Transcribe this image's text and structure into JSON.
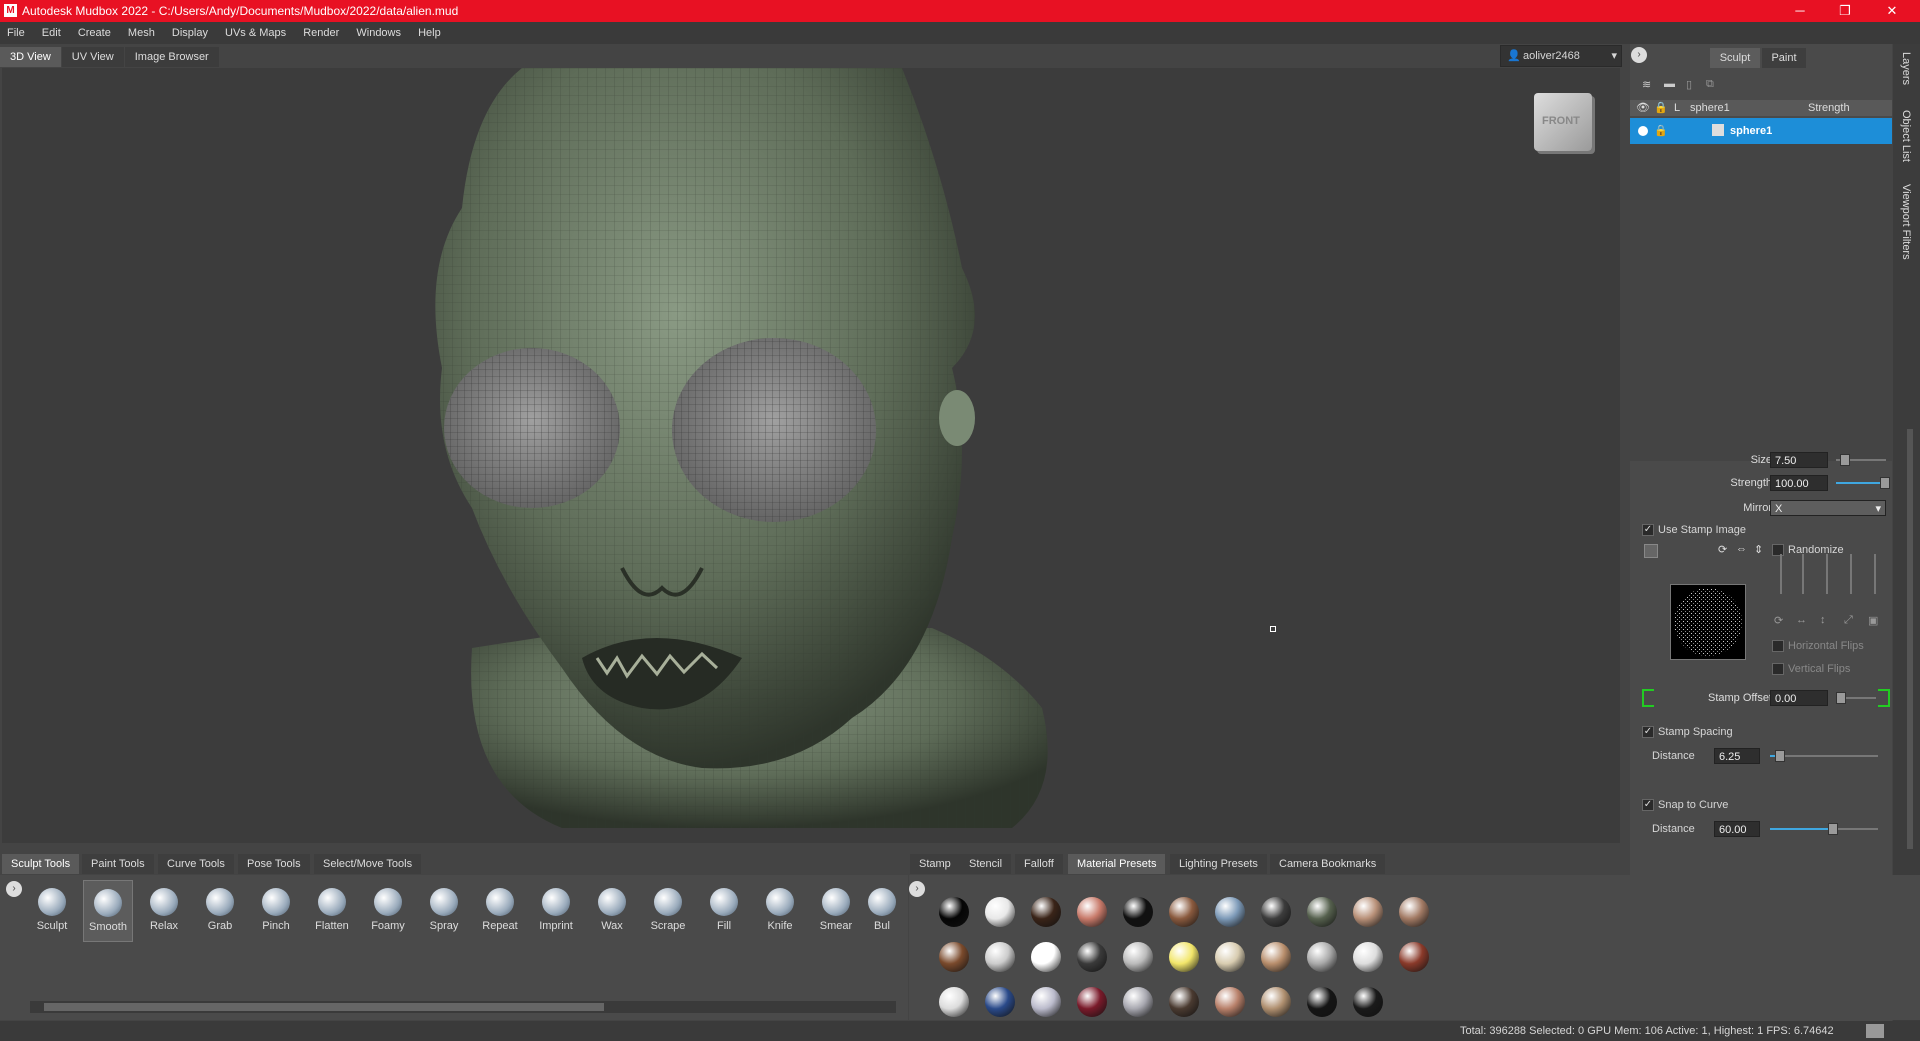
{
  "window": {
    "title": "Autodesk Mudbox 2022 - C:/Users/Andy/Documents/Mudbox/2022/data/alien.mud",
    "minimize": "─",
    "maximize": "❐",
    "close": "✕"
  },
  "menu": [
    "File",
    "Edit",
    "Create",
    "Mesh",
    "Display",
    "UVs & Maps",
    "Render",
    "Windows",
    "Help"
  ],
  "view_tabs": [
    "3D View",
    "UV View",
    "Image Browser"
  ],
  "user": {
    "name": "aoliver2468"
  },
  "viewcube": {
    "label": "FRONT"
  },
  "mode_tabs": [
    "Sculpt",
    "Paint"
  ],
  "side_tabs": [
    "Layers",
    "Object List",
    "Viewport Filters"
  ],
  "layers": {
    "header_name": "sphere1",
    "header_strength": "Strength",
    "header_l": "L",
    "row_name": "sphere1"
  },
  "properties": {
    "size_label": "Size",
    "size_value": "7.50",
    "size_level": 0.08,
    "strength_label": "Strength",
    "strength_value": "100.00",
    "strength_level": 1.0,
    "mirror_label": "Mirror",
    "mirror_value": "X",
    "use_stamp_label": "Use Stamp Image",
    "randomize_label": "Randomize",
    "hflips_label": "Horizontal Flips",
    "vflips_label": "Vertical Flips",
    "stamp_offset_label": "Stamp Offset",
    "stamp_offset_value": "0.00",
    "stamp_spacing_label": "Stamp Spacing",
    "distance1_label": "Distance",
    "distance1_value": "6.25",
    "snap_label": "Snap to Curve",
    "distance2_label": "Distance",
    "distance2_value": "60.00"
  },
  "tool_tabs": [
    "Sculpt Tools",
    "Paint Tools",
    "Curve Tools",
    "Pose Tools",
    "Select/Move Tools"
  ],
  "tools": [
    "Sculpt",
    "Smooth",
    "Relax",
    "Grab",
    "Pinch",
    "Flatten",
    "Foamy",
    "Spray",
    "Repeat",
    "Imprint",
    "Wax",
    "Scrape",
    "Fill",
    "Knife",
    "Smear",
    "Bul"
  ],
  "tray_tabs": [
    "Stamp",
    "Stencil",
    "Falloff",
    "Material Presets",
    "Lighting Presets",
    "Camera Bookmarks"
  ],
  "materials": [
    [
      "#050505",
      "#e8e8e8",
      "#3a2418",
      "#c87a6a",
      "#111111",
      "#8a5a3e",
      "#7d9ab8",
      "#3c3c3c",
      "#56614e",
      "#b89078",
      "#a27a64"
    ],
    [
      "#7a4a2c",
      "#cccccc",
      "#ffffff",
      "#3a3a3a",
      "#bbbbbb",
      "#f2e66a",
      "#d8ccb0",
      "#b88e6c",
      "#aaaaaa",
      "#dddddd",
      "#8a3a2a"
    ],
    [
      "#dcdcdc",
      "#2a4a8a",
      "#bbbbcc",
      "#7a1a2a",
      "#a8a8b0",
      "#4a3a30",
      "#b8806a",
      "#b09070",
      "#151515",
      "#1a1a1a"
    ]
  ],
  "status": "Total: 396288  Selected: 0 GPU Mem: 106  Active: 1, Highest: 1  FPS: 6.74642",
  "colors": {
    "titlebar": "#e81123",
    "selection": "#1d8ed8",
    "accent": "#3fa7e0"
  }
}
